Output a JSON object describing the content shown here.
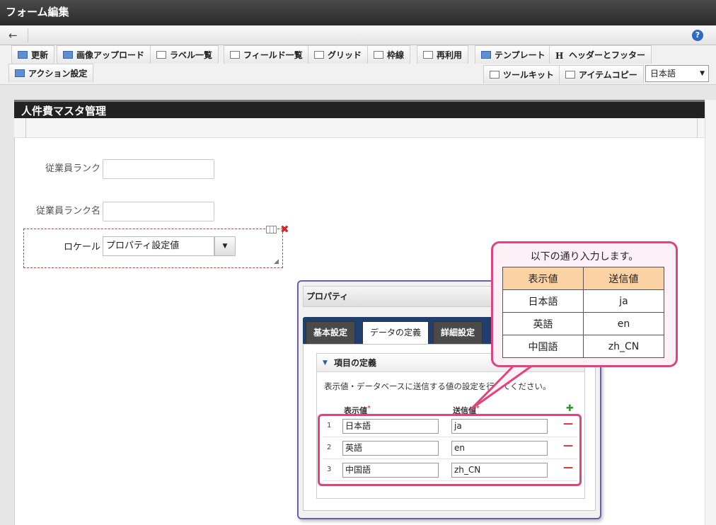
{
  "window": {
    "title": "フォーム編集"
  },
  "navbar": {
    "back_icon": "arrow-left-icon",
    "help_label": "?"
  },
  "toolbar": {
    "row1": [
      {
        "label": "更新",
        "icon": "refresh-icon"
      },
      {
        "label": "画像アップロード",
        "icon": "image-upload-icon"
      },
      {
        "label": "ラベル一覧",
        "icon": "label-list-icon"
      },
      {
        "label": "フィールド一覧",
        "icon": "field-list-icon"
      },
      {
        "label": "グリッド",
        "icon": "grid-icon"
      },
      {
        "label": "枠線",
        "icon": "border-icon"
      },
      {
        "label": "再利用",
        "icon": "reuse-icon"
      },
      {
        "label": "テンプレート",
        "icon": "template-icon"
      },
      {
        "label": "ヘッダーとフッター",
        "icon": "header-footer-icon",
        "glyph": "H"
      }
    ],
    "row2_left": {
      "label": "アクション設定",
      "icon": "action-icon"
    },
    "row2_right": [
      {
        "label": "ツールキット",
        "icon": "toolkit-icon"
      },
      {
        "label": "アイテムコピー",
        "icon": "item-copy-icon"
      }
    ],
    "language": "日本語"
  },
  "form": {
    "section_title": "人件費マスタ管理",
    "fields": [
      {
        "label": "従業員ランク",
        "value": ""
      },
      {
        "label": "従業員ランク名",
        "value": ""
      }
    ],
    "locale": {
      "label": "ロケール",
      "value": "プロパティ設定値"
    }
  },
  "properties_panel": {
    "title": "プロパティ",
    "tabs": [
      "基本設定",
      "データの定義",
      "詳細設定"
    ],
    "active_tab": "データの定義",
    "section_title": "項目の定義",
    "description": "表示値・データベースに送信する値の設定を行ってください。",
    "columns": {
      "display": "表示値",
      "send": "送信値",
      "required_mark": "*"
    },
    "rows": [
      {
        "num": "1",
        "display": "日本語",
        "send": "ja"
      },
      {
        "num": "2",
        "display": "英語",
        "send": "en"
      },
      {
        "num": "3",
        "display": "中国語",
        "send": "zh_CN"
      }
    ]
  },
  "callout": {
    "text": "以下の通り入力します。",
    "headers": [
      "表示値",
      "送信値"
    ],
    "rows": [
      [
        "日本語",
        "ja"
      ],
      [
        "英語",
        "en"
      ],
      [
        "中国語",
        "zh_CN"
      ]
    ]
  },
  "colors": {
    "callout_border": "#e0447e",
    "callout_header_bg": "#fbd2a4",
    "panel_tabbar": "#1f3f6e",
    "delete_red": "#dd2222",
    "add_green": "#2a9a2a"
  }
}
